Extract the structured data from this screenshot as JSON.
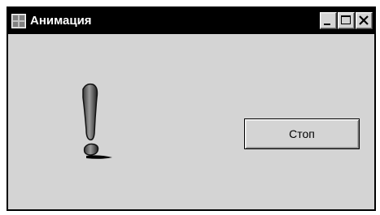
{
  "window": {
    "title": "Анимация",
    "icon": "app-window-icon",
    "controls": [
      "minimize-icon",
      "maximize-icon",
      "close-icon"
    ]
  },
  "content": {
    "animation_icon": "exclamation-icon",
    "stop_button_label": "Стоп"
  },
  "colors": {
    "titlebar": "#000000",
    "client_background": "#d4d4d4",
    "button_face": "#d4d4d4"
  }
}
